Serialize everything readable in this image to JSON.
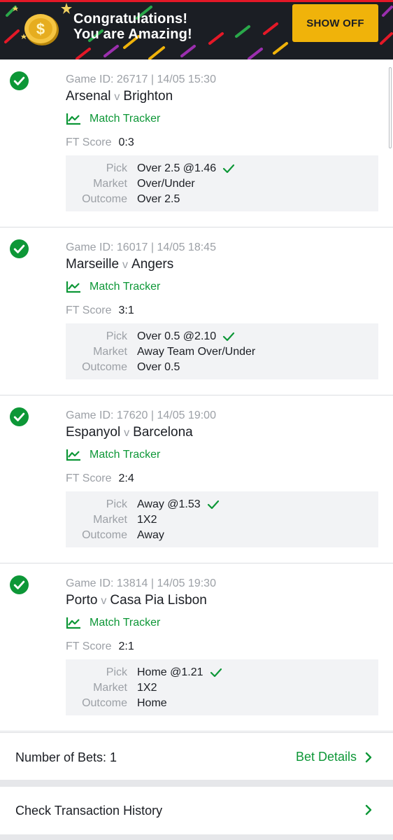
{
  "banner": {
    "line1": "Congratulations!",
    "line2": "You are Amazing!",
    "button_label": "SHOW OFF",
    "icon": "gold-coin-icon",
    "accent_color": "#f0b30a"
  },
  "bets": [
    {
      "game_id": "Game ID: 26717 | 14/05 15:30",
      "home": "Arsenal",
      "vs": "v",
      "away": "Brighton",
      "tracker_label": "Match Tracker",
      "ft_label": "FT Score",
      "ft_score": "0:3",
      "pick_label": "Pick",
      "pick": "Over 2.5 @1.46",
      "market_label": "Market",
      "market": "Over/Under",
      "outcome_label": "Outcome",
      "outcome": "Over 2.5",
      "status": "won"
    },
    {
      "game_id": "Game ID: 16017 | 14/05 18:45",
      "home": "Marseille",
      "vs": "v",
      "away": "Angers",
      "tracker_label": "Match Tracker",
      "ft_label": "FT Score",
      "ft_score": "3:1",
      "pick_label": "Pick",
      "pick": "Over 0.5 @2.10",
      "market_label": "Market",
      "market": "Away Team Over/Under",
      "outcome_label": "Outcome",
      "outcome": "Over 0.5",
      "status": "won"
    },
    {
      "game_id": "Game ID: 17620 | 14/05 19:00",
      "home": "Espanyol",
      "vs": "v",
      "away": "Barcelona",
      "tracker_label": "Match Tracker",
      "ft_label": "FT Score",
      "ft_score": "2:4",
      "pick_label": "Pick",
      "pick": "Away @1.53",
      "market_label": "Market",
      "market": "1X2",
      "outcome_label": "Outcome",
      "outcome": "Away",
      "status": "won"
    },
    {
      "game_id": "Game ID: 13814 | 14/05 19:30",
      "home": "Porto",
      "vs": "v",
      "away": "Casa Pia Lisbon",
      "tracker_label": "Match Tracker",
      "ft_label": "FT Score",
      "ft_score": "2:1",
      "pick_label": "Pick",
      "pick": "Home @1.21",
      "market_label": "Market",
      "market": "1X2",
      "outcome_label": "Outcome",
      "outcome": "Home",
      "status": "won"
    }
  ],
  "summary": {
    "bets_count_label": "Number of Bets: 1",
    "details_link": "Bet Details"
  },
  "history": {
    "label": "Check Transaction History"
  },
  "colors": {
    "success_green": "#0d9737",
    "banner_bg": "#1b1e24",
    "top_line_red": "#e41827"
  }
}
